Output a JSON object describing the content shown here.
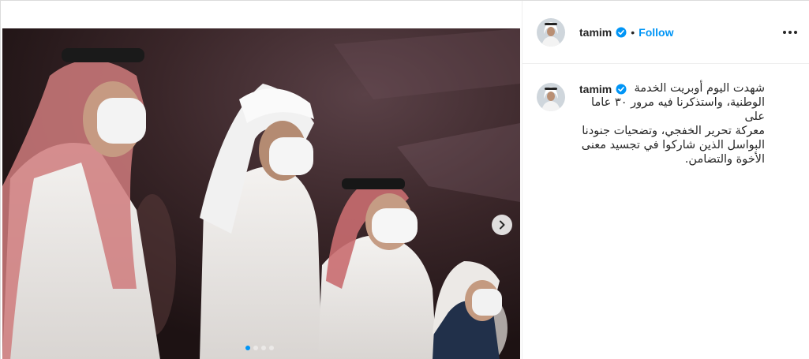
{
  "post": {
    "username": "tamim",
    "verified": true,
    "separator": "•",
    "follow_label": "Follow",
    "more_icon": "more-options-icon",
    "carousel": {
      "next_icon": "chevron-right-icon",
      "slide_count": 4,
      "active_index": 0
    }
  },
  "caption": {
    "username": "tamim",
    "lines": [
      "شهدت اليوم أوبريت الخدمة",
      "الوطنية، واستذكرنا فيه مرور ٣٠ عاما على",
      "معركة تحرير الخفجي، وتضحيات جنودنا",
      "البواسل الذين شاركوا في تجسيد معنى",
      "الأخوة والتضامن."
    ]
  },
  "colors": {
    "link_blue": "#0095f6",
    "text": "#262626",
    "border": "#dbdbdb"
  }
}
